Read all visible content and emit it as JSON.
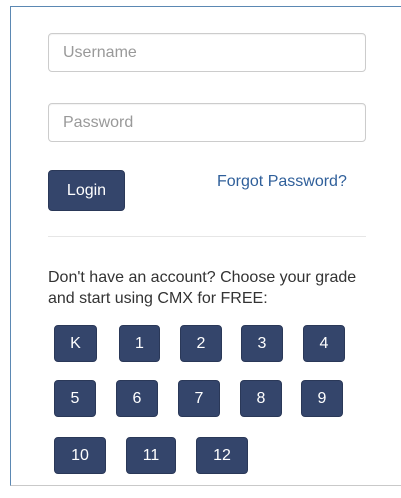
{
  "login_form": {
    "username_placeholder": "Username",
    "password_placeholder": "Password",
    "login_label": "Login",
    "forgot_password_label": "Forgot Password?"
  },
  "signup": {
    "prompt": "Don't have an account? Choose your grade and start using CMX for FREE:",
    "grades": [
      "K",
      "1",
      "2",
      "3",
      "4",
      "5",
      "6",
      "7",
      "8",
      "9",
      "10",
      "11",
      "12"
    ]
  },
  "colors": {
    "button_bg": "#34456b",
    "link": "#2f5f9a",
    "panel_border": "#5b88b3"
  }
}
